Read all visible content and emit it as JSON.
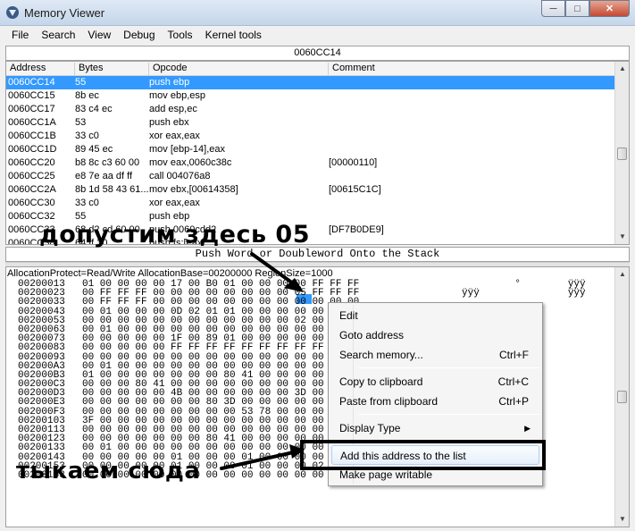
{
  "window": {
    "title": "Memory Viewer",
    "min": "─",
    "max": "□",
    "close": "✕"
  },
  "menu": [
    "File",
    "Search",
    "View",
    "Debug",
    "Tools",
    "Kernel tools"
  ],
  "disasm": {
    "address_bar": "0060CC14",
    "columns": [
      "Address",
      "Bytes",
      "Opcode",
      "Comment"
    ],
    "rows": [
      {
        "addr": "0060CC14",
        "bytes": "55",
        "op": "push ebp",
        "cmt": ""
      },
      {
        "addr": "0060CC15",
        "bytes": "8b ec",
        "op": "mov ebp,esp",
        "cmt": ""
      },
      {
        "addr": "0060CC17",
        "bytes": "83 c4 ec",
        "op": "add esp,ec",
        "cmt": ""
      },
      {
        "addr": "0060CC1A",
        "bytes": "53",
        "op": "push ebx",
        "cmt": ""
      },
      {
        "addr": "0060CC1B",
        "bytes": "33 c0",
        "op": "xor eax,eax",
        "cmt": ""
      },
      {
        "addr": "0060CC1D",
        "bytes": "89 45 ec",
        "op": "mov [ebp-14],eax",
        "cmt": ""
      },
      {
        "addr": "0060CC20",
        "bytes": "b8 8c c3 60 00",
        "op": "mov eax,0060c38c",
        "cmt": "[00000110]"
      },
      {
        "addr": "0060CC25",
        "bytes": "e8 7e aa df ff",
        "op": "call 004076a8",
        "cmt": ""
      },
      {
        "addr": "0060CC2A",
        "bytes": "8b 1d 58 43 61...",
        "op": "mov ebx,[00614358]",
        "cmt": "[00615C1C]"
      },
      {
        "addr": "0060CC30",
        "bytes": "33 c0",
        "op": "xor eax,eax",
        "cmt": ""
      },
      {
        "addr": "0060CC32",
        "bytes": "55",
        "op": "push ebp",
        "cmt": ""
      },
      {
        "addr": "0060CC33",
        "bytes": "68 d2 cd 60 00",
        "op": "push 0060cdd2",
        "cmt": "[DF7B0DE9]"
      },
      {
        "addr": "0060CC38",
        "bytes": "64 ff 30",
        "op": "push fs:[eax]",
        "cmt": ""
      }
    ],
    "description": "Push Word or Doubleword Onto the Stack"
  },
  "hex": {
    "header": "AllocationProtect=Read/Write  AllocationBase=00200000 RegionSize=1000",
    "rows": [
      {
        "a": "00200013",
        "b": "01 00 00 00 00 17 00 B0 01 00 00 00 00 FF FF FF",
        "s": "         °        ÿÿÿ"
      },
      {
        "a": "00200023",
        "b": "00 FF FF FF 00 00 00 00 00 00 00 00 05 FF FF FF",
        "s": "ÿÿÿ               ÿÿÿ"
      },
      {
        "a": "00200033",
        "b": "00 FF FF FF 00 00 00 00 00 00 00 00 00 00 00 00",
        "s": ""
      },
      {
        "a": "00200043",
        "b": "00 01 00 00 00 0D 02 01 01 00 00 00 00 00 00 00",
        "s": ""
      },
      {
        "a": "00200053",
        "b": "00 00 00 00 00 00 00 00 00 00 00 00 02 00 00 00",
        "s": ""
      },
      {
        "a": "00200063",
        "b": "00 01 00 00 00 00 00 00 00 00 00 00 00 00 00 00",
        "s": ""
      },
      {
        "a": "00200073",
        "b": "00 00 00 00 00 1F 00 89 01 00 00 00 00 00 00 00",
        "s": ""
      },
      {
        "a": "00200083",
        "b": "00 00 00 00 00 FF FF FF FF FF FF FF FF FF FF FF",
        "s": ""
      },
      {
        "a": "00200093",
        "b": "00 00 00 00 00 00 00 00 00 00 00 00 00 00 00 00",
        "s": ""
      },
      {
        "a": "002000A3",
        "b": "00 01 00 00 00 00 00 00 00 00 00 00 00 00 00 00",
        "s": ""
      },
      {
        "a": "002000B3",
        "b": "01 00 00 00 00 00 00 00 80 41 00 00 00 00 00 00",
        "s": ""
      },
      {
        "a": "002000C3",
        "b": "00 00 00 80 41 00 00 00 00 00 00 00 00 00 00 00",
        "s": ""
      },
      {
        "a": "002000D3",
        "b": "00 00 00 00 00 4B 00 00 00 00 00 00 3D 00 00 00",
        "s": ""
      },
      {
        "a": "002000E3",
        "b": "00 00 00 00 00 00 00 80 3D 00 00 00 00 00 00 00",
        "s": ""
      },
      {
        "a": "002000F3",
        "b": "00 00 00 00 00 00 00 00 00 53 78 00 00 00 00 00",
        "s": ""
      },
      {
        "a": "00200103",
        "b": "3F 00 00 00 00 00 00 00 00 00 00 00 00 00 00 00",
        "s": ""
      },
      {
        "a": "00200113",
        "b": "00 00 00 00 00 00 00 00 00 00 00 00 00 00 00 00",
        "s": ""
      },
      {
        "a": "00200123",
        "b": "00 00 00 00 00 00 00 80 41 00 00 00 00 00 00 00",
        "s": ""
      },
      {
        "a": "00200133",
        "b": "00 01 00 00 00 00 00 00 00 00 00 00 00 00 00 00",
        "s": ""
      },
      {
        "a": "00200143",
        "b": "00 00 00 00 00 01 00 00 00 01 00 00 00 00 00 00",
        "s": ""
      },
      {
        "a": "00200153",
        "b": "00 00 00 00 00 01 00 00 00 01 00 00 00 02 18 00",
        "s": ""
      },
      {
        "a": "00200163",
        "b": "00 00 00 00 00 00 00 00 00 00 00 00 00 00 00 00",
        "s": ""
      }
    ]
  },
  "context_menu": {
    "items": [
      {
        "label": "Edit",
        "shortcut": ""
      },
      {
        "label": "Goto address",
        "shortcut": ""
      },
      {
        "label": "Search memory...",
        "shortcut": "Ctrl+F"
      },
      {
        "label": "Copy to clipboard",
        "shortcut": "Ctrl+C"
      },
      {
        "label": "Paste from clipboard",
        "shortcut": "Ctrl+P"
      },
      {
        "label": "Display Type",
        "shortcut": "▶"
      },
      {
        "label": "Add this address to the list",
        "shortcut": ""
      },
      {
        "label": "Make page writable",
        "shortcut": ""
      }
    ]
  },
  "annotations": {
    "top": "допустим здесь 05",
    "bottom": "тыкаем сюда"
  }
}
